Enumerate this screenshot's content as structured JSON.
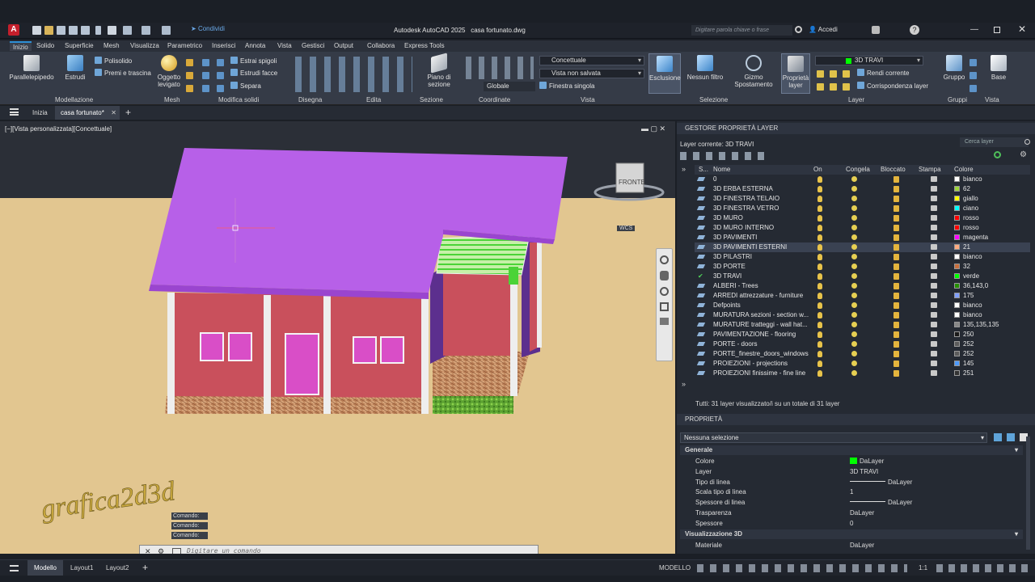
{
  "titlebar": {
    "app_title": "Autodesk AutoCAD 2025",
    "file_name": "casa fortunato.dwg",
    "share_label": "Condividi",
    "search_placeholder": "Digitare parola chiave o frase",
    "signin_label": "Accedi",
    "app_letter": "A"
  },
  "ribbon_tabs": [
    "Inizio",
    "Solido",
    "Superficie",
    "Mesh",
    "Visualizza",
    "Parametrico",
    "Inserisci",
    "Annota",
    "Vista",
    "Gestisci",
    "Output",
    "Collabora",
    "Express Tools"
  ],
  "ribbon": {
    "panels": [
      "Modellazione",
      "Mesh",
      "Modifica solidi",
      "Disegna",
      "Edita",
      "Sezione",
      "Coordinate",
      "Vista",
      "Selezione",
      "Layer",
      "Gruppi",
      "Vista"
    ],
    "big_buttons": {
      "parallelepipedo": "Parallelepipedo",
      "estrudi": "Estrudi",
      "oggetto_levigato": "Oggetto levigato",
      "piano_sezione": "Piano di sezione",
      "esclusione": "Esclusione",
      "nessun_filtro": "Nessun filtro",
      "gizmo": "Gizmo Spostamento",
      "proprieta_layer": "Proprietà layer",
      "gruppo": "Gruppo",
      "base": "Base"
    },
    "small": {
      "polisolido": "Polisolido",
      "premi_trascina": "Premi e trascina",
      "estrai_spigoli": "Estrai spigoli",
      "estrudi_facce": "Estrudi facce",
      "separa": "Separa",
      "globale": "Globale",
      "finestra_singola": "Finestra singola",
      "rendi_corrente": "Rendi corrente",
      "corrispondenza_layer": "Corrispondenza layer"
    },
    "combos": {
      "visual_style": "Concettuale",
      "view_state": "Vista non salvata",
      "layer_current": "3D TRAVI"
    }
  },
  "file_tabs": {
    "start": "Inizia",
    "doc": "casa fortunato*"
  },
  "viewport": {
    "label": "[−][Vista personalizzata][Concettuale]",
    "viewcube_face": "FRONTE",
    "ucs_label": "WCS",
    "watermark": "grafica2d3d",
    "command_history": [
      "Comando:",
      "Comando:",
      "Comando:"
    ],
    "command_placeholder": "Digitare un comando"
  },
  "layer_manager": {
    "title": "GESTORE PROPRIETÀ LAYER",
    "current_layer": "Layer corrente: 3D TRAVI",
    "search_placeholder": "Cerca layer",
    "columns": [
      "S...",
      "Nome",
      "On",
      "Congela",
      "Bloccato",
      "Stampa",
      "Colore"
    ],
    "layers": [
      {
        "name": "0",
        "color": "bianco",
        "swatch": "#ffffff"
      },
      {
        "name": "3D ERBA ESTERNA",
        "color": "62",
        "swatch": "#9fd43a"
      },
      {
        "name": "3D FINESTRA TELAIO",
        "color": "giallo",
        "swatch": "#ffff00"
      },
      {
        "name": "3D FINESTRA VETRO",
        "color": "ciano",
        "swatch": "#00ffff"
      },
      {
        "name": "3D MURO",
        "color": "rosso",
        "swatch": "#ff0000"
      },
      {
        "name": "3D MURO INTERNO",
        "color": "rosso",
        "swatch": "#ff0000"
      },
      {
        "name": "3D PAVIMENTI",
        "color": "magenta",
        "swatch": "#ff00ff"
      },
      {
        "name": "3D PAVIMENTI ESTERNI",
        "color": "21",
        "swatch": "#ffaa7f"
      },
      {
        "name": "3D PILASTRI",
        "color": "bianco",
        "swatch": "#ffffff"
      },
      {
        "name": "3D PORTE",
        "color": "32",
        "swatch": "#c86e3c"
      },
      {
        "name": "3D TRAVI",
        "color": "verde",
        "swatch": "#00ff00"
      },
      {
        "name": "ALBERI - Trees",
        "color": "36,143,0",
        "swatch": "#248f00"
      },
      {
        "name": "ARREDI attrezzature - furniture",
        "color": "175",
        "swatch": "#7f9fff"
      },
      {
        "name": "Defpoints",
        "color": "bianco",
        "swatch": "#ffffff"
      },
      {
        "name": "MURATURA sezioni - section w...",
        "color": "bianco",
        "swatch": "#ffffff"
      },
      {
        "name": "MURATURE tratteggi - wall hat...",
        "color": "135,135,135",
        "swatch": "#878787"
      },
      {
        "name": "PAVIMENTAZIONE - flooring",
        "color": "250",
        "swatch": "#1a1a1a"
      },
      {
        "name": "PORTE - doors",
        "color": "252",
        "swatch": "#5b5b5b"
      },
      {
        "name": "PORTE_finestre_doors_windows",
        "color": "252",
        "swatch": "#5b5b5b"
      },
      {
        "name": "PROIEZIONI - projections",
        "color": "145",
        "swatch": "#4c99ff"
      },
      {
        "name": "PROIEZIONI finissime - fine line",
        "color": "251",
        "swatch": "#333333"
      }
    ],
    "selected_index": 7,
    "current_index": 10,
    "summary": "Tutti: 31 layer visualizzato/i su un totale di 31 layer"
  },
  "properties": {
    "title": "PROPRIETÀ",
    "selection": "Nessuna selezione",
    "section_general": "Generale",
    "section_3d": "Visualizzazione 3D",
    "rows": [
      {
        "key": "Colore",
        "value": "DaLayer"
      },
      {
        "key": "Layer",
        "value": "3D TRAVI"
      },
      {
        "key": "Tipo di linea",
        "value": "DaLayer"
      },
      {
        "key": "Scala tipo di linea",
        "value": "1"
      },
      {
        "key": "Spessore di linea",
        "value": "DaLayer"
      },
      {
        "key": "Trasparenza",
        "value": "DaLayer"
      },
      {
        "key": "Spessore",
        "value": "0"
      }
    ],
    "material": {
      "key": "Materiale",
      "value": "DaLayer"
    }
  },
  "statusbar": {
    "tabs": [
      "Modello",
      "Layout1",
      "Layout2"
    ],
    "space": "MODELLO",
    "scale": "1:1"
  }
}
